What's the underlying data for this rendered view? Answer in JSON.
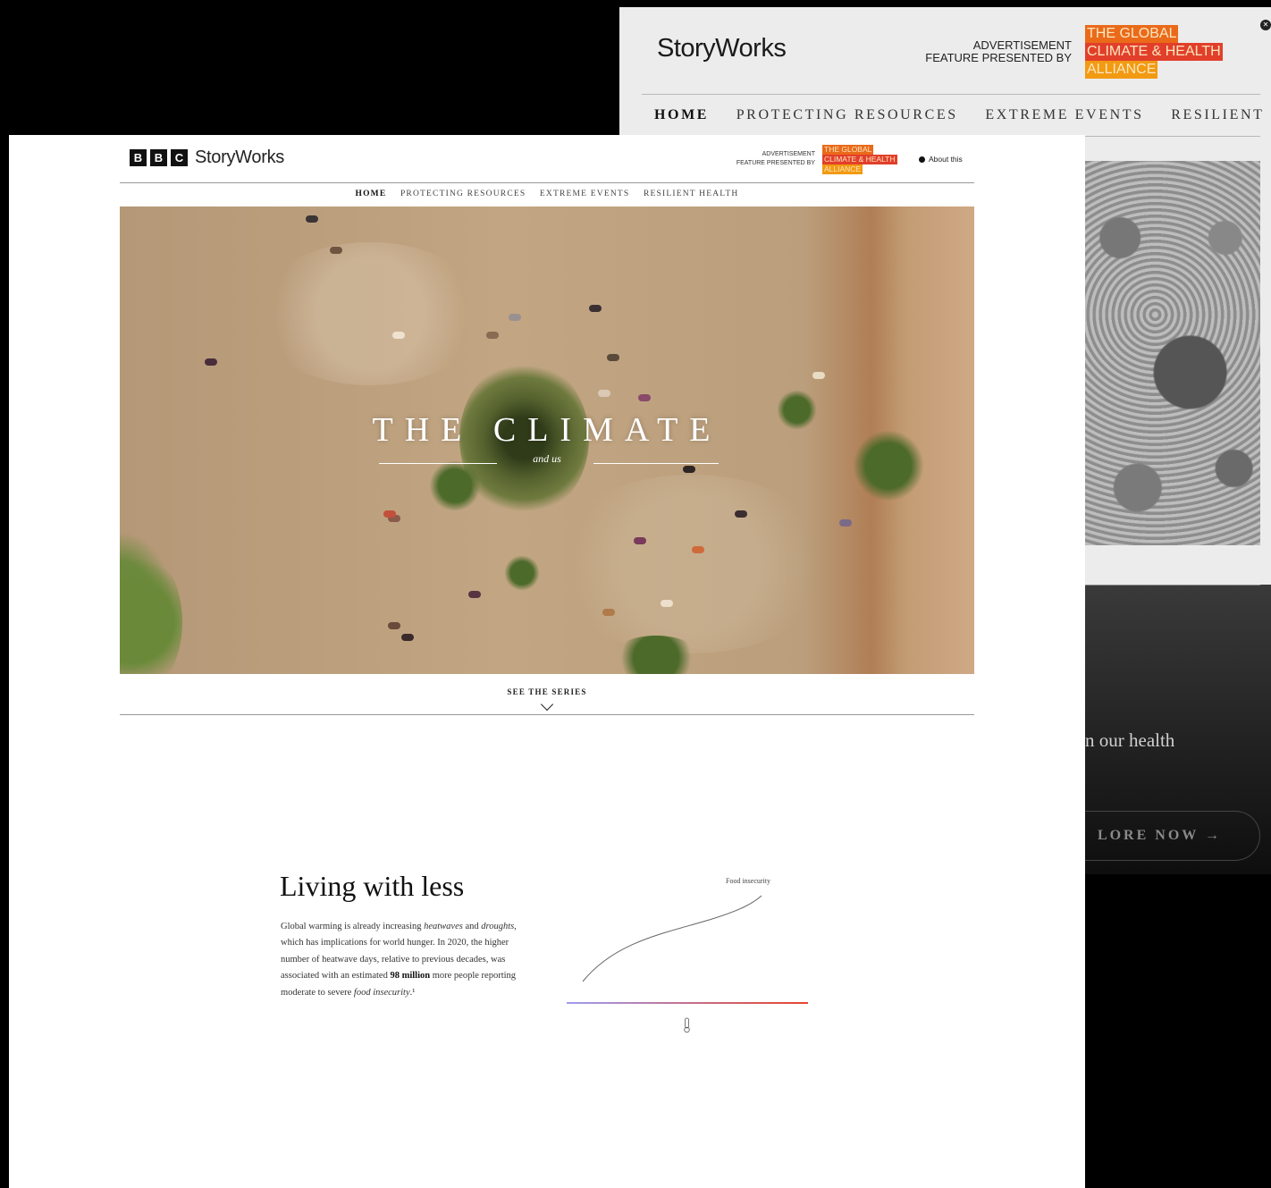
{
  "back_window": {
    "logo": "StoryWorks",
    "advertisement": "ADVERTISEMENT",
    "presented_by": "FEATURE PRESENTED BY",
    "brand_lines": [
      "THE GLOBAL",
      "CLIMATE & HEALTH",
      "ALLIANCE"
    ],
    "nav": [
      "HOME",
      "PROTECTING RESOURCES",
      "EXTREME EVENTS",
      "RESILIENT"
    ],
    "subtext": "n our health",
    "explore_label": "LORE NOW →"
  },
  "front_window": {
    "bbc_letters": [
      "B",
      "B",
      "C"
    ],
    "logo": "StoryWorks",
    "advertisement": "ADVERTISEMENT",
    "presented_by": "FEATURE PRESENTED BY",
    "brand_lines": [
      "THE GLOBAL",
      "CLIMATE & HEALTH",
      "ALLIANCE"
    ],
    "about_label": "About this",
    "nav": [
      "HOME",
      "PROTECTING RESOURCES",
      "EXTREME EVENTS",
      "RESILIENT HEALTH"
    ],
    "hero_title": "THE CLIMATE",
    "hero_subtitle": "and us",
    "see_series": "SEE THE SERIES"
  },
  "section": {
    "title": "Living with less",
    "body": [
      {
        "t": "Global warming is already increasing "
      },
      {
        "t": "heatwaves",
        "i": true
      },
      {
        "t": " and "
      },
      {
        "t": "droughts",
        "i": true
      },
      {
        "t": ", which has implications for world hunger. In 2020, the higher number of heatwave days, relative to previous decades, was associated with an estimated "
      },
      {
        "t": "98 million",
        "b": true
      },
      {
        "t": " more people reporting moderate to severe "
      },
      {
        "t": "food insecurity",
        "i": true
      },
      {
        "t": ".¹"
      }
    ],
    "chart_label": "Food insecurity",
    "colors": {
      "gradient_start": "#9e9cf0",
      "gradient_end": "#e8442c"
    }
  }
}
